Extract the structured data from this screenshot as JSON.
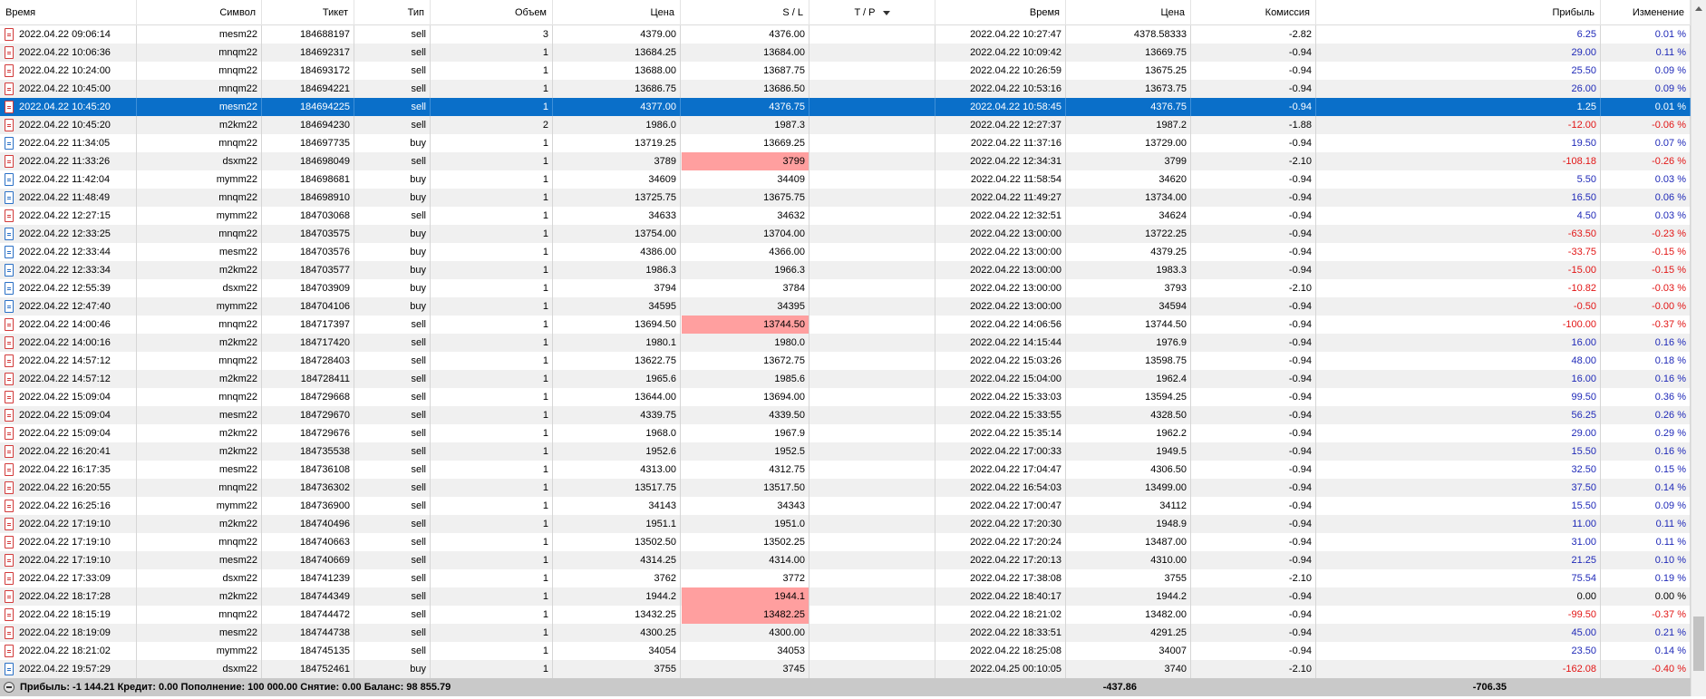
{
  "columns": [
    {
      "key": "time_open",
      "label": "Время"
    },
    {
      "key": "symbol",
      "label": "Символ"
    },
    {
      "key": "ticket",
      "label": "Тикет"
    },
    {
      "key": "type",
      "label": "Тип"
    },
    {
      "key": "volume",
      "label": "Объем"
    },
    {
      "key": "price_open",
      "label": "Цена"
    },
    {
      "key": "sl",
      "label": "S / L"
    },
    {
      "key": "tp",
      "label": "T / P"
    },
    {
      "key": "time_close",
      "label": "Время"
    },
    {
      "key": "price_close",
      "label": "Цена"
    },
    {
      "key": "commission",
      "label": "Комиссия"
    },
    {
      "key": "profit",
      "label": "Прибыль"
    },
    {
      "key": "change",
      "label": "Изменение"
    }
  ],
  "selected_row": 4,
  "rows": [
    {
      "time_open": "2022.04.22 09:06:14",
      "symbol": "mesm22",
      "ticket": "184688197",
      "type": "sell",
      "volume": "3",
      "price_open": "4379.00",
      "sl": "4376.00",
      "tp": "",
      "time_close": "2022.04.22 10:27:47",
      "price_close": "4378.58333",
      "commission": "-2.82",
      "profit": "6.25",
      "change": "0.01 %",
      "sign": "pos",
      "sl_hl": false
    },
    {
      "time_open": "2022.04.22 10:06:36",
      "symbol": "mnqm22",
      "ticket": "184692317",
      "type": "sell",
      "volume": "1",
      "price_open": "13684.25",
      "sl": "13684.00",
      "tp": "",
      "time_close": "2022.04.22 10:09:42",
      "price_close": "13669.75",
      "commission": "-0.94",
      "profit": "29.00",
      "change": "0.11 %",
      "sign": "pos",
      "sl_hl": false
    },
    {
      "time_open": "2022.04.22 10:24:00",
      "symbol": "mnqm22",
      "ticket": "184693172",
      "type": "sell",
      "volume": "1",
      "price_open": "13688.00",
      "sl": "13687.75",
      "tp": "",
      "time_close": "2022.04.22 10:26:59",
      "price_close": "13675.25",
      "commission": "-0.94",
      "profit": "25.50",
      "change": "0.09 %",
      "sign": "pos",
      "sl_hl": false
    },
    {
      "time_open": "2022.04.22 10:45:00",
      "symbol": "mnqm22",
      "ticket": "184694221",
      "type": "sell",
      "volume": "1",
      "price_open": "13686.75",
      "sl": "13686.50",
      "tp": "",
      "time_close": "2022.04.22 10:53:16",
      "price_close": "13673.75",
      "commission": "-0.94",
      "profit": "26.00",
      "change": "0.09 %",
      "sign": "pos",
      "sl_hl": false
    },
    {
      "time_open": "2022.04.22 10:45:20",
      "symbol": "mesm22",
      "ticket": "184694225",
      "type": "sell",
      "volume": "1",
      "price_open": "4377.00",
      "sl": "4376.75",
      "tp": "",
      "time_close": "2022.04.22 10:58:45",
      "price_close": "4376.75",
      "commission": "-0.94",
      "profit": "1.25",
      "change": "0.01 %",
      "sign": "pos",
      "sl_hl": false
    },
    {
      "time_open": "2022.04.22 10:45:20",
      "symbol": "m2km22",
      "ticket": "184694230",
      "type": "sell",
      "volume": "2",
      "price_open": "1986.0",
      "sl": "1987.3",
      "tp": "",
      "time_close": "2022.04.22 12:27:37",
      "price_close": "1987.2",
      "commission": "-1.88",
      "profit": "-12.00",
      "change": "-0.06 %",
      "sign": "neg",
      "sl_hl": false
    },
    {
      "time_open": "2022.04.22 11:34:05",
      "symbol": "mnqm22",
      "ticket": "184697735",
      "type": "buy",
      "volume": "1",
      "price_open": "13719.25",
      "sl": "13669.25",
      "tp": "",
      "time_close": "2022.04.22 11:37:16",
      "price_close": "13729.00",
      "commission": "-0.94",
      "profit": "19.50",
      "change": "0.07 %",
      "sign": "pos",
      "sl_hl": false
    },
    {
      "time_open": "2022.04.22 11:33:26",
      "symbol": "dsxm22",
      "ticket": "184698049",
      "type": "sell",
      "volume": "1",
      "price_open": "3789",
      "sl": "3799",
      "tp": "",
      "time_close": "2022.04.22 12:34:31",
      "price_close": "3799",
      "commission": "-2.10",
      "profit": "-108.18",
      "change": "-0.26 %",
      "sign": "neg",
      "sl_hl": true
    },
    {
      "time_open": "2022.04.22 11:42:04",
      "symbol": "mymm22",
      "ticket": "184698681",
      "type": "buy",
      "volume": "1",
      "price_open": "34609",
      "sl": "34409",
      "tp": "",
      "time_close": "2022.04.22 11:58:54",
      "price_close": "34620",
      "commission": "-0.94",
      "profit": "5.50",
      "change": "0.03 %",
      "sign": "pos",
      "sl_hl": false
    },
    {
      "time_open": "2022.04.22 11:48:49",
      "symbol": "mnqm22",
      "ticket": "184698910",
      "type": "buy",
      "volume": "1",
      "price_open": "13725.75",
      "sl": "13675.75",
      "tp": "",
      "time_close": "2022.04.22 11:49:27",
      "price_close": "13734.00",
      "commission": "-0.94",
      "profit": "16.50",
      "change": "0.06 %",
      "sign": "pos",
      "sl_hl": false
    },
    {
      "time_open": "2022.04.22 12:27:15",
      "symbol": "mymm22",
      "ticket": "184703068",
      "type": "sell",
      "volume": "1",
      "price_open": "34633",
      "sl": "34632",
      "tp": "",
      "time_close": "2022.04.22 12:32:51",
      "price_close": "34624",
      "commission": "-0.94",
      "profit": "4.50",
      "change": "0.03 %",
      "sign": "pos",
      "sl_hl": false
    },
    {
      "time_open": "2022.04.22 12:33:25",
      "symbol": "mnqm22",
      "ticket": "184703575",
      "type": "buy",
      "volume": "1",
      "price_open": "13754.00",
      "sl": "13704.00",
      "tp": "",
      "time_close": "2022.04.22 13:00:00",
      "price_close": "13722.25",
      "commission": "-0.94",
      "profit": "-63.50",
      "change": "-0.23 %",
      "sign": "neg",
      "sl_hl": false
    },
    {
      "time_open": "2022.04.22 12:33:44",
      "symbol": "mesm22",
      "ticket": "184703576",
      "type": "buy",
      "volume": "1",
      "price_open": "4386.00",
      "sl": "4366.00",
      "tp": "",
      "time_close": "2022.04.22 13:00:00",
      "price_close": "4379.25",
      "commission": "-0.94",
      "profit": "-33.75",
      "change": "-0.15 %",
      "sign": "neg",
      "sl_hl": false
    },
    {
      "time_open": "2022.04.22 12:33:34",
      "symbol": "m2km22",
      "ticket": "184703577",
      "type": "buy",
      "volume": "1",
      "price_open": "1986.3",
      "sl": "1966.3",
      "tp": "",
      "time_close": "2022.04.22 13:00:00",
      "price_close": "1983.3",
      "commission": "-0.94",
      "profit": "-15.00",
      "change": "-0.15 %",
      "sign": "neg",
      "sl_hl": false
    },
    {
      "time_open": "2022.04.22 12:55:39",
      "symbol": "dsxm22",
      "ticket": "184703909",
      "type": "buy",
      "volume": "1",
      "price_open": "3794",
      "sl": "3784",
      "tp": "",
      "time_close": "2022.04.22 13:00:00",
      "price_close": "3793",
      "commission": "-2.10",
      "profit": "-10.82",
      "change": "-0.03 %",
      "sign": "neg",
      "sl_hl": false
    },
    {
      "time_open": "2022.04.22 12:47:40",
      "symbol": "mymm22",
      "ticket": "184704106",
      "type": "buy",
      "volume": "1",
      "price_open": "34595",
      "sl": "34395",
      "tp": "",
      "time_close": "2022.04.22 13:00:00",
      "price_close": "34594",
      "commission": "-0.94",
      "profit": "-0.50",
      "change": "-0.00 %",
      "sign": "neg",
      "sl_hl": false
    },
    {
      "time_open": "2022.04.22 14:00:46",
      "symbol": "mnqm22",
      "ticket": "184717397",
      "type": "sell",
      "volume": "1",
      "price_open": "13694.50",
      "sl": "13744.50",
      "tp": "",
      "time_close": "2022.04.22 14:06:56",
      "price_close": "13744.50",
      "commission": "-0.94",
      "profit": "-100.00",
      "change": "-0.37 %",
      "sign": "neg",
      "sl_hl": true
    },
    {
      "time_open": "2022.04.22 14:00:16",
      "symbol": "m2km22",
      "ticket": "184717420",
      "type": "sell",
      "volume": "1",
      "price_open": "1980.1",
      "sl": "1980.0",
      "tp": "",
      "time_close": "2022.04.22 14:15:44",
      "price_close": "1976.9",
      "commission": "-0.94",
      "profit": "16.00",
      "change": "0.16 %",
      "sign": "pos",
      "sl_hl": false
    },
    {
      "time_open": "2022.04.22 14:57:12",
      "symbol": "mnqm22",
      "ticket": "184728403",
      "type": "sell",
      "volume": "1",
      "price_open": "13622.75",
      "sl": "13672.75",
      "tp": "",
      "time_close": "2022.04.22 15:03:26",
      "price_close": "13598.75",
      "commission": "-0.94",
      "profit": "48.00",
      "change": "0.18 %",
      "sign": "pos",
      "sl_hl": false
    },
    {
      "time_open": "2022.04.22 14:57:12",
      "symbol": "m2km22",
      "ticket": "184728411",
      "type": "sell",
      "volume": "1",
      "price_open": "1965.6",
      "sl": "1985.6",
      "tp": "",
      "time_close": "2022.04.22 15:04:00",
      "price_close": "1962.4",
      "commission": "-0.94",
      "profit": "16.00",
      "change": "0.16 %",
      "sign": "pos",
      "sl_hl": false
    },
    {
      "time_open": "2022.04.22 15:09:04",
      "symbol": "mnqm22",
      "ticket": "184729668",
      "type": "sell",
      "volume": "1",
      "price_open": "13644.00",
      "sl": "13694.00",
      "tp": "",
      "time_close": "2022.04.22 15:33:03",
      "price_close": "13594.25",
      "commission": "-0.94",
      "profit": "99.50",
      "change": "0.36 %",
      "sign": "pos",
      "sl_hl": false
    },
    {
      "time_open": "2022.04.22 15:09:04",
      "symbol": "mesm22",
      "ticket": "184729670",
      "type": "sell",
      "volume": "1",
      "price_open": "4339.75",
      "sl": "4339.50",
      "tp": "",
      "time_close": "2022.04.22 15:33:55",
      "price_close": "4328.50",
      "commission": "-0.94",
      "profit": "56.25",
      "change": "0.26 %",
      "sign": "pos",
      "sl_hl": false
    },
    {
      "time_open": "2022.04.22 15:09:04",
      "symbol": "m2km22",
      "ticket": "184729676",
      "type": "sell",
      "volume": "1",
      "price_open": "1968.0",
      "sl": "1967.9",
      "tp": "",
      "time_close": "2022.04.22 15:35:14",
      "price_close": "1962.2",
      "commission": "-0.94",
      "profit": "29.00",
      "change": "0.29 %",
      "sign": "pos",
      "sl_hl": false
    },
    {
      "time_open": "2022.04.22 16:20:41",
      "symbol": "m2km22",
      "ticket": "184735538",
      "type": "sell",
      "volume": "1",
      "price_open": "1952.6",
      "sl": "1952.5",
      "tp": "",
      "time_close": "2022.04.22 17:00:33",
      "price_close": "1949.5",
      "commission": "-0.94",
      "profit": "15.50",
      "change": "0.16 %",
      "sign": "pos",
      "sl_hl": false
    },
    {
      "time_open": "2022.04.22 16:17:35",
      "symbol": "mesm22",
      "ticket": "184736108",
      "type": "sell",
      "volume": "1",
      "price_open": "4313.00",
      "sl": "4312.75",
      "tp": "",
      "time_close": "2022.04.22 17:04:47",
      "price_close": "4306.50",
      "commission": "-0.94",
      "profit": "32.50",
      "change": "0.15 %",
      "sign": "pos",
      "sl_hl": false
    },
    {
      "time_open": "2022.04.22 16:20:55",
      "symbol": "mnqm22",
      "ticket": "184736302",
      "type": "sell",
      "volume": "1",
      "price_open": "13517.75",
      "sl": "13517.50",
      "tp": "",
      "time_close": "2022.04.22 16:54:03",
      "price_close": "13499.00",
      "commission": "-0.94",
      "profit": "37.50",
      "change": "0.14 %",
      "sign": "pos",
      "sl_hl": false
    },
    {
      "time_open": "2022.04.22 16:25:16",
      "symbol": "mymm22",
      "ticket": "184736900",
      "type": "sell",
      "volume": "1",
      "price_open": "34143",
      "sl": "34343",
      "tp": "",
      "time_close": "2022.04.22 17:00:47",
      "price_close": "34112",
      "commission": "-0.94",
      "profit": "15.50",
      "change": "0.09 %",
      "sign": "pos",
      "sl_hl": false
    },
    {
      "time_open": "2022.04.22 17:19:10",
      "symbol": "m2km22",
      "ticket": "184740496",
      "type": "sell",
      "volume": "1",
      "price_open": "1951.1",
      "sl": "1951.0",
      "tp": "",
      "time_close": "2022.04.22 17:20:30",
      "price_close": "1948.9",
      "commission": "-0.94",
      "profit": "11.00",
      "change": "0.11 %",
      "sign": "pos",
      "sl_hl": false
    },
    {
      "time_open": "2022.04.22 17:19:10",
      "symbol": "mnqm22",
      "ticket": "184740663",
      "type": "sell",
      "volume": "1",
      "price_open": "13502.50",
      "sl": "13502.25",
      "tp": "",
      "time_close": "2022.04.22 17:20:24",
      "price_close": "13487.00",
      "commission": "-0.94",
      "profit": "31.00",
      "change": "0.11 %",
      "sign": "pos",
      "sl_hl": false
    },
    {
      "time_open": "2022.04.22 17:19:10",
      "symbol": "mesm22",
      "ticket": "184740669",
      "type": "sell",
      "volume": "1",
      "price_open": "4314.25",
      "sl": "4314.00",
      "tp": "",
      "time_close": "2022.04.22 17:20:13",
      "price_close": "4310.00",
      "commission": "-0.94",
      "profit": "21.25",
      "change": "0.10 %",
      "sign": "pos",
      "sl_hl": false
    },
    {
      "time_open": "2022.04.22 17:33:09",
      "symbol": "dsxm22",
      "ticket": "184741239",
      "type": "sell",
      "volume": "1",
      "price_open": "3762",
      "sl": "3772",
      "tp": "",
      "time_close": "2022.04.22 17:38:08",
      "price_close": "3755",
      "commission": "-2.10",
      "profit": "75.54",
      "change": "0.19 %",
      "sign": "pos",
      "sl_hl": false
    },
    {
      "time_open": "2022.04.22 18:17:28",
      "symbol": "m2km22",
      "ticket": "184744349",
      "type": "sell",
      "volume": "1",
      "price_open": "1944.2",
      "sl": "1944.1",
      "tp": "",
      "time_close": "2022.04.22 18:40:17",
      "price_close": "1944.2",
      "commission": "-0.94",
      "profit": "0.00",
      "change": "0.00 %",
      "sign": "zero",
      "sl_hl": true
    },
    {
      "time_open": "2022.04.22 18:15:19",
      "symbol": "mnqm22",
      "ticket": "184744472",
      "type": "sell",
      "volume": "1",
      "price_open": "13432.25",
      "sl": "13482.25",
      "tp": "",
      "time_close": "2022.04.22 18:21:02",
      "price_close": "13482.00",
      "commission": "-0.94",
      "profit": "-99.50",
      "change": "-0.37 %",
      "sign": "neg",
      "sl_hl": true
    },
    {
      "time_open": "2022.04.22 18:19:09",
      "symbol": "mesm22",
      "ticket": "184744738",
      "type": "sell",
      "volume": "1",
      "price_open": "4300.25",
      "sl": "4300.00",
      "tp": "",
      "time_close": "2022.04.22 18:33:51",
      "price_close": "4291.25",
      "commission": "-0.94",
      "profit": "45.00",
      "change": "0.21 %",
      "sign": "pos",
      "sl_hl": false
    },
    {
      "time_open": "2022.04.22 18:21:02",
      "symbol": "mymm22",
      "ticket": "184745135",
      "type": "sell",
      "volume": "1",
      "price_open": "34054",
      "sl": "34053",
      "tp": "",
      "time_close": "2022.04.22 18:25:08",
      "price_close": "34007",
      "commission": "-0.94",
      "profit": "23.50",
      "change": "0.14 %",
      "sign": "pos",
      "sl_hl": false
    },
    {
      "time_open": "2022.04.22 19:57:29",
      "symbol": "dsxm22",
      "ticket": "184752461",
      "type": "buy",
      "volume": "1",
      "price_open": "3755",
      "sl": "3745",
      "tp": "",
      "time_close": "2022.04.25 00:10:05",
      "price_close": "3740",
      "commission": "-2.10",
      "profit": "-162.08",
      "change": "-0.40 %",
      "sign": "neg",
      "sl_hl": false
    }
  ],
  "footer": {
    "summary": "Прибыль: -1 144.21  Кредит: 0.00  Пополнение: 100 000.00  Снятие: 0.00  Баланс: 98 855.79",
    "commission_total": "-437.86",
    "profit_total": "-706.35"
  },
  "colors": {
    "selected_row": "#0a6fc9",
    "sl_highlight": "#ff9f9f",
    "profit_positive": "#1f29b8",
    "profit_negative": "#e21515"
  }
}
